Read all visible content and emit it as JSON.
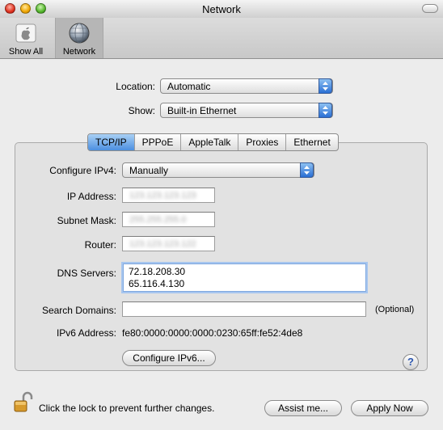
{
  "window": {
    "title": "Network"
  },
  "toolbar": {
    "items": [
      {
        "label": "Show All",
        "icon": "apple-prefs-icon"
      },
      {
        "label": "Network",
        "icon": "network-globe-icon"
      }
    ]
  },
  "location": {
    "label": "Location:",
    "value": "Automatic"
  },
  "show": {
    "label": "Show:",
    "value": "Built-in Ethernet"
  },
  "tabs": [
    {
      "label": "TCP/IP",
      "active": true
    },
    {
      "label": "PPPoE",
      "active": false
    },
    {
      "label": "AppleTalk",
      "active": false
    },
    {
      "label": "Proxies",
      "active": false
    },
    {
      "label": "Ethernet",
      "active": false
    }
  ],
  "tcpip": {
    "configure_label": "Configure IPv4:",
    "configure_value": "Manually",
    "ip_label": "IP Address:",
    "ip_value": "123.123.123.123",
    "subnet_label": "Subnet Mask:",
    "subnet_value": "255.255.255.0",
    "router_label": "Router:",
    "router_value": "123.123.123.122",
    "dns_label": "DNS Servers:",
    "dns_lines": [
      "72.18.208.30",
      "65.116.4.130"
    ],
    "search_label": "Search Domains:",
    "search_value": "",
    "optional_text": "(Optional)",
    "ipv6_label": "IPv6 Address:",
    "ipv6_value": "fe80:0000:0000:0000:0230:65ff:fe52:4de8",
    "configure_ipv6_button": "Configure IPv6...",
    "help_glyph": "?"
  },
  "footer": {
    "lock_text": "Click the lock to prevent further changes.",
    "assist_button": "Assist me...",
    "apply_button": "Apply Now"
  },
  "colors": {
    "accent": "#3a80db",
    "window_bg": "#ececec"
  }
}
